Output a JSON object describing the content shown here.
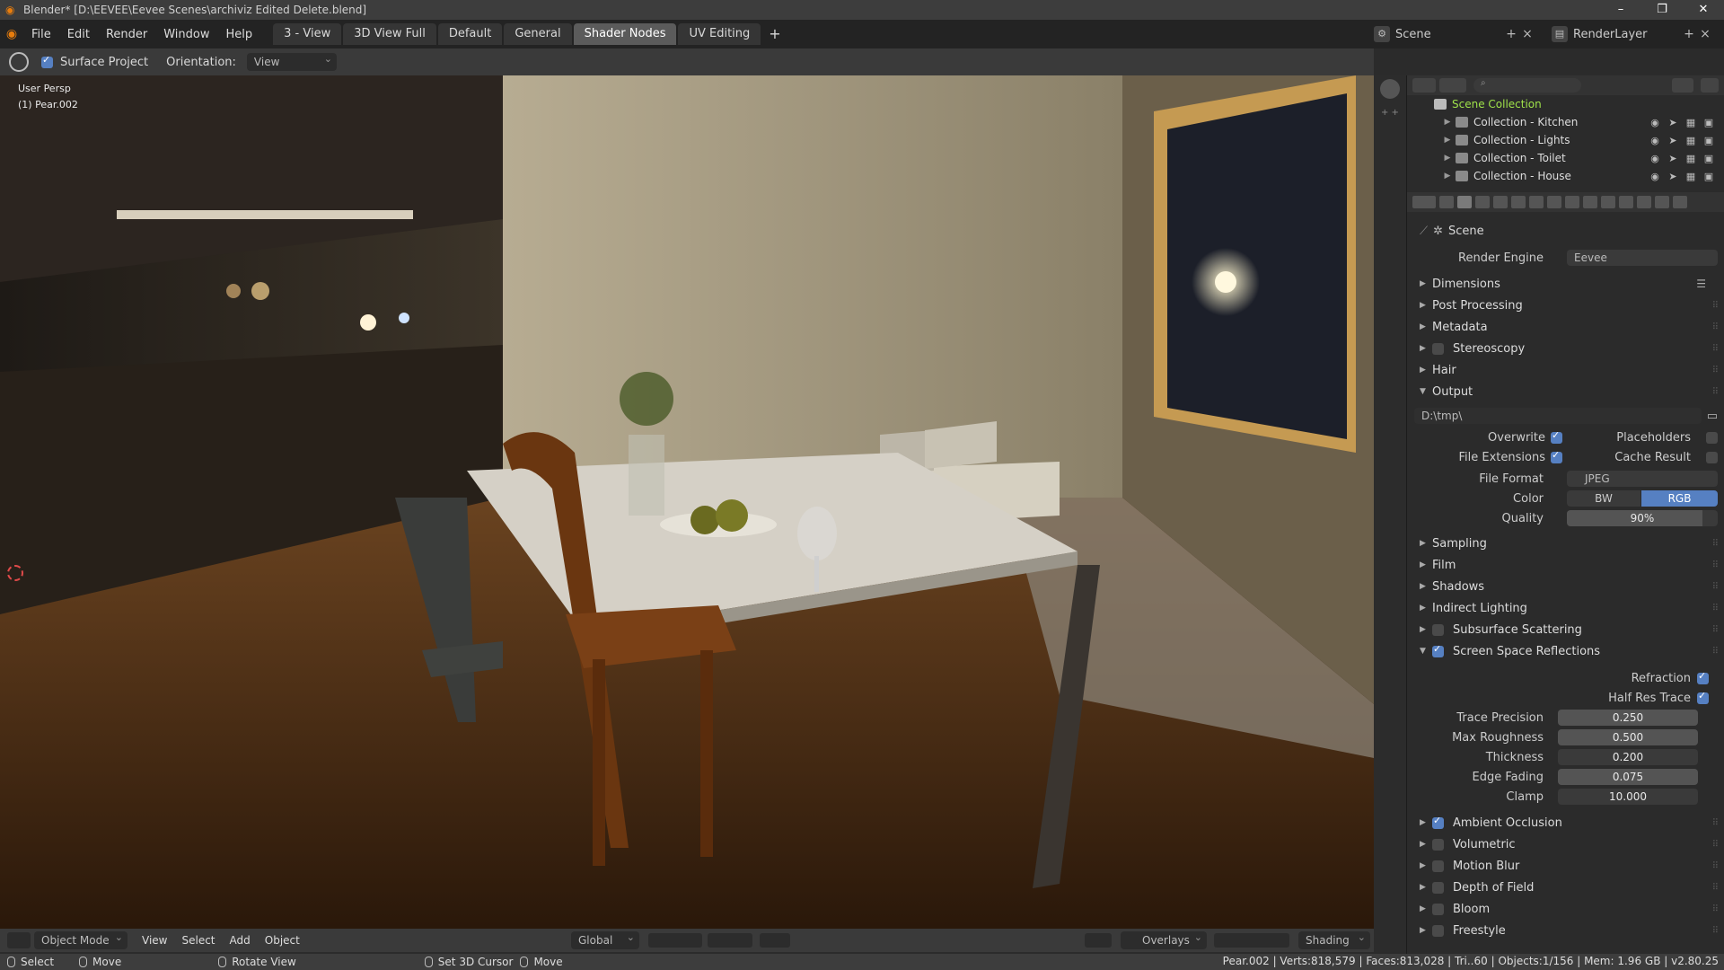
{
  "window": {
    "title": "Blender* [D:\\EEVEE\\Eevee Scenes\\archiviz Edited Delete.blend]"
  },
  "menu": [
    "File",
    "Edit",
    "Render",
    "Window",
    "Help"
  ],
  "workspace_tabs": [
    "3 - View",
    "3D View Full",
    "Default",
    "General",
    "Shader Nodes",
    "UV Editing"
  ],
  "active_tab": "Shader Nodes",
  "scene_selector": {
    "scene": "Scene",
    "render_layer": "RenderLayer"
  },
  "tool_header": {
    "surface_project_label": "Surface Project",
    "surface_project_checked": true,
    "orientation_label": "Orientation:",
    "orientation_value": "View"
  },
  "viewport": {
    "view_name": "User Persp",
    "active_object": "(1) Pear.002"
  },
  "viewport_footer": {
    "mode": "Object Mode",
    "items": [
      "View",
      "Select",
      "Add",
      "Object"
    ],
    "transform": "Global",
    "overlays": "Overlays",
    "shading": "Shading"
  },
  "statusbar": {
    "left": [
      {
        "label": "Select"
      },
      {
        "label": "Move"
      },
      {
        "label": "Rotate View"
      },
      {
        "label": "Set 3D Cursor"
      },
      {
        "label": "Move"
      }
    ],
    "stats": "Pear.002 | Verts:818,579 | Faces:813,028 | Tri..60 | Objects:1/156 | Mem: 1.96 GB | v2.80.25"
  },
  "outliner": {
    "root": "Scene Collection",
    "collections": [
      {
        "name": "Collection - Kitchen"
      },
      {
        "name": "Collection - Lights"
      },
      {
        "name": "Collection - Toilet"
      },
      {
        "name": "Collection - House"
      }
    ]
  },
  "properties": {
    "context": "Scene",
    "render_engine_label": "Render Engine",
    "render_engine_value": "Eevee",
    "panels_top": [
      "Dimensions",
      "Post Processing",
      "Metadata"
    ],
    "stereoscopy": {
      "label": "Stereoscopy",
      "checked": false
    },
    "hair": "Hair",
    "output": {
      "label": "Output",
      "path": "D:\\tmp\\",
      "overwrite_label": "Overwrite",
      "overwrite": true,
      "placeholders_label": "Placeholders",
      "placeholders": false,
      "file_extensions_label": "File Extensions",
      "file_extensions": true,
      "cache_result_label": "Cache Result",
      "cache_result": false,
      "file_format_label": "File Format",
      "file_format_value": "JPEG",
      "color_label": "Color",
      "color_options": [
        "BW",
        "RGB"
      ],
      "color_selected": "RGB",
      "quality_label": "Quality",
      "quality_value": "90%",
      "quality_fraction": 0.9
    },
    "panels_mid": [
      "Sampling",
      "Film",
      "Shadows",
      "Indirect Lighting"
    ],
    "subsurface": {
      "label": "Subsurface Scattering",
      "checked": false
    },
    "ssr": {
      "label": "Screen Space Reflections",
      "checked": true,
      "refraction_label": "Refraction",
      "refraction": true,
      "half_res_label": "Half Res Trace",
      "half_res": true,
      "fields": [
        {
          "label": "Trace Precision",
          "value": "0.250"
        },
        {
          "label": "Max Roughness",
          "value": "0.500"
        },
        {
          "label": "Thickness",
          "value": "0.200"
        },
        {
          "label": "Edge Fading",
          "value": "0.075"
        },
        {
          "label": "Clamp",
          "value": "10.000"
        }
      ]
    },
    "panels_bottom": [
      {
        "label": "Ambient Occlusion",
        "checked": true
      },
      {
        "label": "Volumetric",
        "checked": false
      },
      {
        "label": "Motion Blur",
        "checked": false
      },
      {
        "label": "Depth of Field",
        "checked": false
      },
      {
        "label": "Bloom",
        "checked": false
      },
      {
        "label": "Freestyle",
        "checked": false
      }
    ]
  },
  "colors": {
    "accent_blue": "#5680c2",
    "blender_orange": "#e87d0d",
    "scene_green": "#9fe24a"
  }
}
